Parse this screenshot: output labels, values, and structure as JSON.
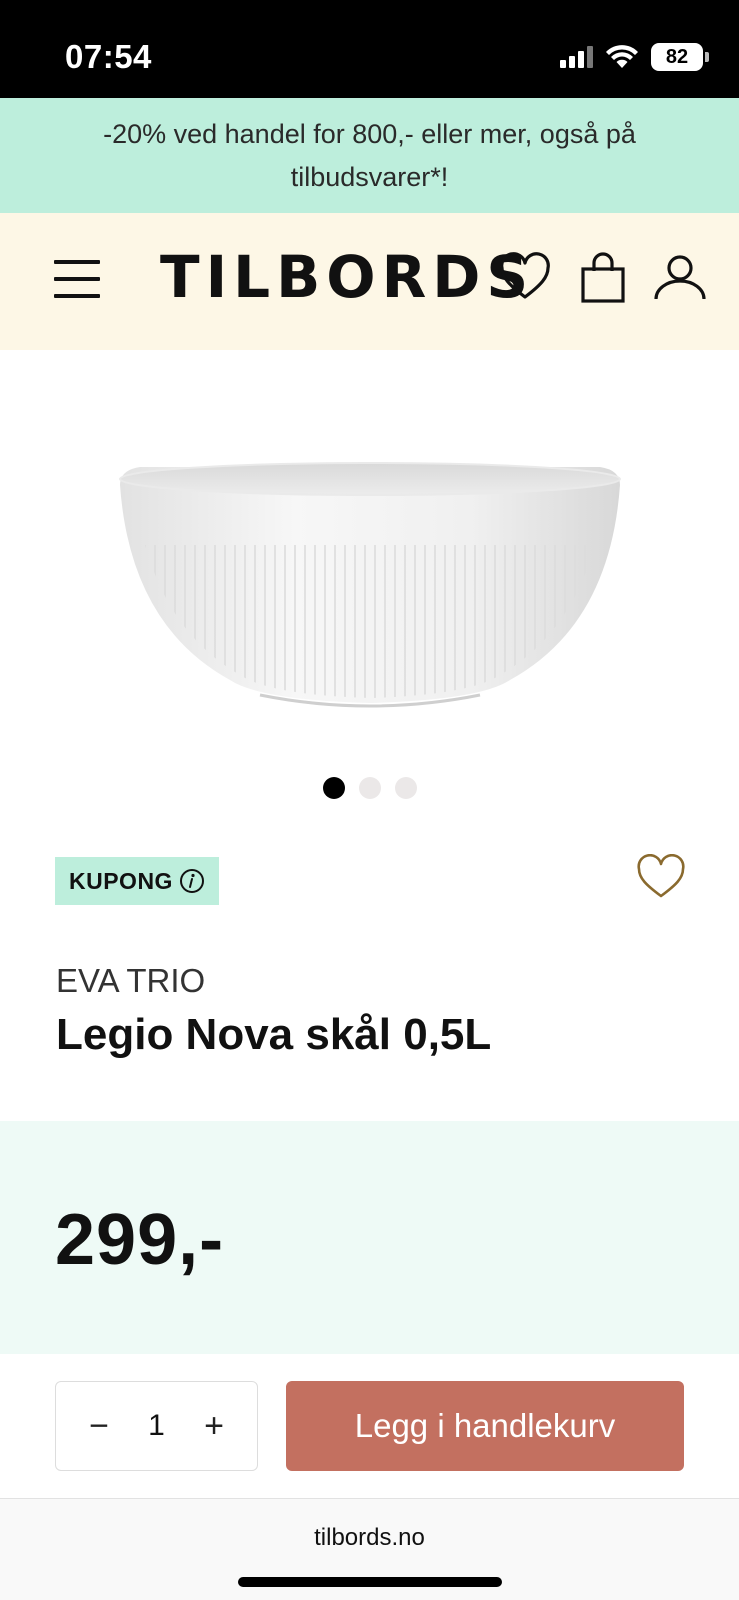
{
  "status_bar": {
    "time": "07:54",
    "battery": "82",
    "icons": [
      "signal-icon",
      "wifi-icon",
      "battery-icon"
    ]
  },
  "promo": {
    "text": "-20% ved handel for 800,- eller mer, også på tilbudsvarer*!"
  },
  "header": {
    "logo": "TILBORDS",
    "icons": [
      "menu-icon",
      "heart-icon",
      "shopping-bag-icon",
      "user-icon"
    ]
  },
  "product": {
    "image_alt": "white ribbed bowl",
    "carousel": {
      "total": 3,
      "active": 1
    },
    "badge": "KUPONG",
    "brand": "EVA TRIO",
    "title": "Legio Nova skål 0,5L",
    "price": "299,-"
  },
  "purchase": {
    "qty_minus": "−",
    "quantity": "1",
    "qty_plus": "+",
    "add_to_cart": "Legg i handlekurv"
  },
  "browser": {
    "url": "tilbords.no"
  },
  "colors": {
    "promo_bg": "#bdeedc",
    "header_bg": "#fdf7e6",
    "price_bg": "#eefaf6",
    "cta_bg": "#c37060",
    "wishlist_accent": "#8a6a2e"
  }
}
